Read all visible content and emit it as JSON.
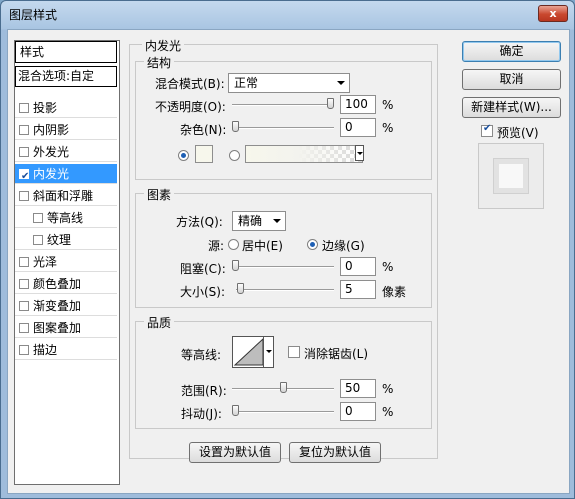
{
  "window": {
    "title": "图层样式",
    "close_symbol": "x"
  },
  "style_list": {
    "header": "样式",
    "blend_options": "混合选项:自定",
    "items": [
      {
        "label": "投影",
        "checked": false
      },
      {
        "label": "内阴影",
        "checked": false
      },
      {
        "label": "外发光",
        "checked": false
      },
      {
        "label": "内发光",
        "checked": true
      },
      {
        "label": "斜面和浮雕",
        "checked": false
      },
      {
        "label": "等高线",
        "checked": false
      },
      {
        "label": "纹理",
        "checked": false
      },
      {
        "label": "光泽",
        "checked": false
      },
      {
        "label": "颜色叠加",
        "checked": false
      },
      {
        "label": "渐变叠加",
        "checked": false
      },
      {
        "label": "图案叠加",
        "checked": false
      },
      {
        "label": "描边",
        "checked": false
      }
    ]
  },
  "panel": {
    "title": "内发光",
    "structure": {
      "title": "结构",
      "blend_mode_label": "混合模式(B):",
      "blend_mode_value": "正常",
      "opacity_label": "不透明度(O):",
      "opacity_value": "100",
      "opacity_percent": 100,
      "noise_label": "杂色(N):",
      "noise_value": "0",
      "noise_percent": 0,
      "unit": "%"
    },
    "elements": {
      "title": "图素",
      "method_label": "方法(Q):",
      "method_value": "精确",
      "source_label": "源:",
      "source_center": "居中(E)",
      "source_edge": "边缘(G)",
      "choke_label": "阻塞(C):",
      "choke_value": "0",
      "choke_percent": 0,
      "size_label": "大小(S):",
      "size_value": "5",
      "size_unit": "像素",
      "unit": "%"
    },
    "quality": {
      "title": "品质",
      "contour_label": "等高线:",
      "anti_alias_label": "消除锯齿(L)",
      "range_label": "范围(R):",
      "range_value": "50",
      "range_percent": 50,
      "jitter_label": "抖动(J):",
      "jitter_value": "0",
      "jitter_percent": 0,
      "unit": "%"
    },
    "make_default": "设置为默认值",
    "reset_default": "复位为默认值"
  },
  "buttons": {
    "ok": "确定",
    "cancel": "取消",
    "new_style": "新建样式(W)...",
    "preview": "预览(V)"
  },
  "colors": {
    "selection": "#3399ff",
    "glow_swatch": "#f7f7ec"
  }
}
